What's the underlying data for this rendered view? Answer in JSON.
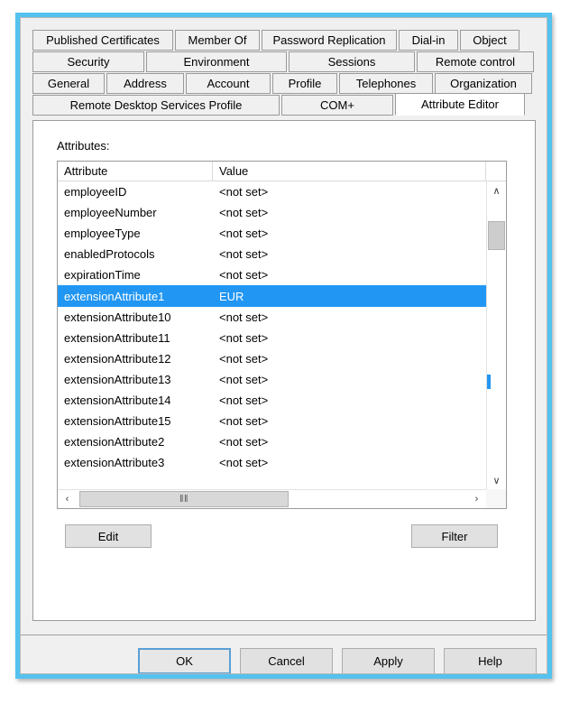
{
  "dialog": {
    "frame_color": "#54c2ef",
    "background": "#f0f0f0",
    "selection_color": "#2196f3"
  },
  "tabs": {
    "rows": [
      [
        "Published Certificates",
        "Member Of",
        "Password Replication",
        "Dial-in",
        "Object"
      ],
      [
        "Security",
        "Environment",
        "Sessions",
        "Remote control"
      ],
      [
        "General",
        "Address",
        "Account",
        "Profile",
        "Telephones",
        "Organization"
      ],
      [
        "Remote Desktop Services Profile",
        "COM+",
        "Attribute Editor"
      ]
    ],
    "selected": "Attribute Editor"
  },
  "attribute_editor": {
    "label": "Attributes:",
    "columns": [
      "Attribute",
      "Value"
    ],
    "rows": [
      {
        "attribute": "employeeID",
        "value": "<not set>",
        "selected": false
      },
      {
        "attribute": "employeeNumber",
        "value": "<not set>",
        "selected": false
      },
      {
        "attribute": "employeeType",
        "value": "<not set>",
        "selected": false
      },
      {
        "attribute": "enabledProtocols",
        "value": "<not set>",
        "selected": false
      },
      {
        "attribute": "expirationTime",
        "value": "<not set>",
        "selected": false
      },
      {
        "attribute": "extensionAttribute1",
        "value": "EUR",
        "selected": true
      },
      {
        "attribute": "extensionAttribute10",
        "value": "<not set>",
        "selected": false
      },
      {
        "attribute": "extensionAttribute11",
        "value": "<not set>",
        "selected": false
      },
      {
        "attribute": "extensionAttribute12",
        "value": "<not set>",
        "selected": false
      },
      {
        "attribute": "extensionAttribute13",
        "value": "<not set>",
        "selected": false
      },
      {
        "attribute": "extensionAttribute14",
        "value": "<not set>",
        "selected": false
      },
      {
        "attribute": "extensionAttribute15",
        "value": "<not set>",
        "selected": false
      },
      {
        "attribute": "extensionAttribute2",
        "value": "<not set>",
        "selected": false
      },
      {
        "attribute": "extensionAttribute3",
        "value": "<not set>",
        "selected": false
      }
    ],
    "edit_label": "Edit",
    "filter_label": "Filter",
    "scrollbars": {
      "up_icon": "∧",
      "down_icon": "∨",
      "left_icon": "‹",
      "right_icon": "›",
      "thumb_grip": "‖‖"
    }
  },
  "buttons": {
    "ok": "OK",
    "cancel": "Cancel",
    "apply": "Apply",
    "help": "Help"
  }
}
